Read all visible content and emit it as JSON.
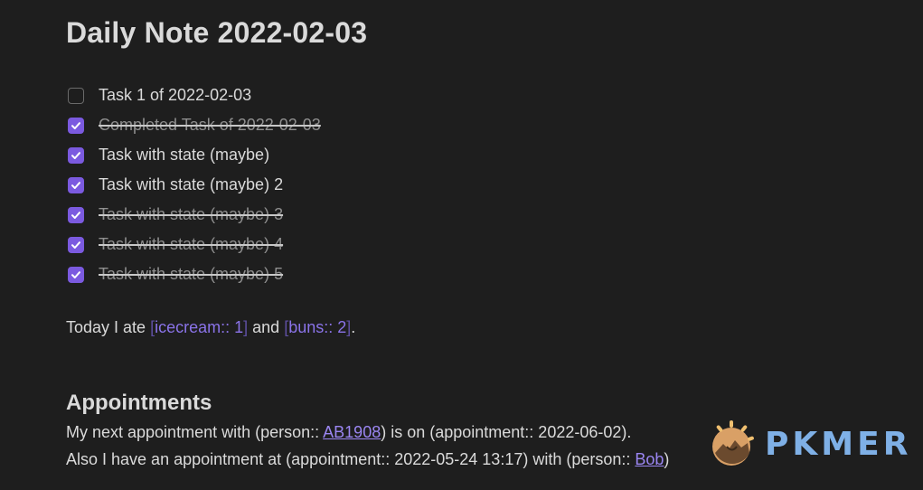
{
  "note": {
    "title": "Daily Note 2022-02-03"
  },
  "tasks": [
    {
      "label": "Task 1 of 2022-02-03",
      "checked": false,
      "struck": false
    },
    {
      "label": "Completed Task of 2022-02-03",
      "checked": true,
      "struck": true
    },
    {
      "label": "Task with state (maybe)",
      "checked": true,
      "struck": false
    },
    {
      "label": "Task with state (maybe) 2",
      "checked": true,
      "struck": false
    },
    {
      "label": "Task with state (maybe) 3",
      "checked": true,
      "struck": true
    },
    {
      "label": "Task with state (maybe) 4",
      "checked": true,
      "struck": true
    },
    {
      "label": "Task with state (maybe) 5",
      "checked": true,
      "struck": true
    }
  ],
  "food": {
    "prefix": "Today I ate ",
    "field1_open": "[",
    "field1_text": "icecream:: 1",
    "field1_close": "]",
    "middle": " and ",
    "field2_open": "[",
    "field2_text": "buns:: 2",
    "field2_close": "]",
    "suffix": "."
  },
  "appointments": {
    "heading": "Appointments",
    "line1_prefix": "My next appointment with (person:: ",
    "line1_link": "AB1908",
    "line1_suffix": ") is on (appointment:: 2022-06-02).",
    "line2_prefix": "Also I have an appointment at (appointment:: 2022-05-24 13:17) with (person:: ",
    "line2_link": "Bob",
    "line2_suffix": ")"
  },
  "watermark": {
    "text": "PKMER",
    "icon": "pkmer-logo-icon"
  },
  "colors": {
    "background": "#1e1e1e",
    "accent": "#7b5ae0",
    "link": "#9b86f2",
    "text": "#dadada",
    "muted": "#8f8f8f"
  }
}
